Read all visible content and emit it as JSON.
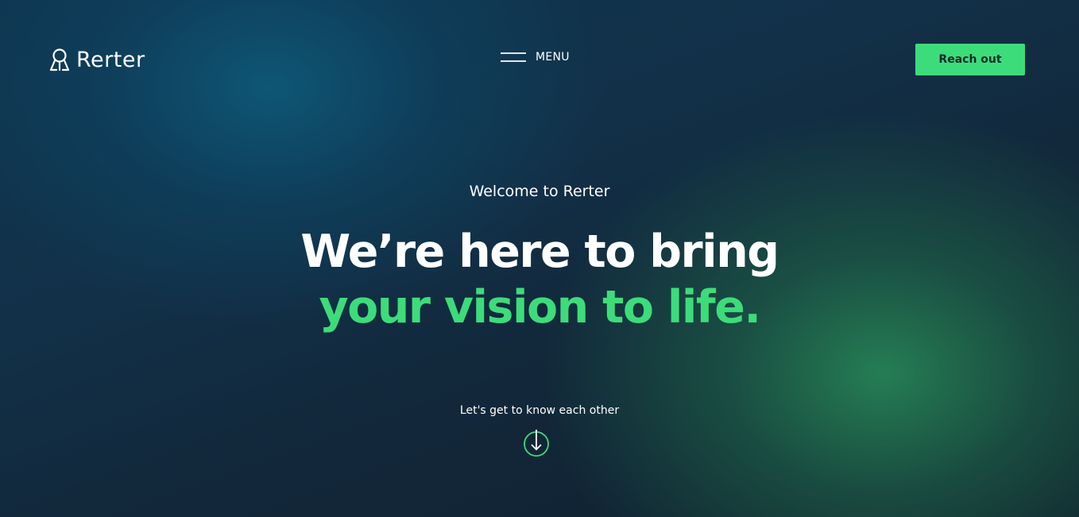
{
  "header": {
    "logo_text": "Rerter",
    "menu_label": "MENU",
    "cta_label": "Reach out"
  },
  "hero": {
    "welcome": "Welcome to Rerter",
    "headline_line1": "We’re here to bring",
    "headline_line2": "your vision to life.",
    "scroll_prompt": "Let's get to know each other"
  },
  "icons": {
    "logo": "rerter-logo-icon",
    "menu": "hamburger-menu-icon",
    "scroll": "arrow-down-circle-icon"
  },
  "colors": {
    "accent": "#3ddc7a",
    "text": "#ffffff",
    "button_text": "#0f2a2c"
  }
}
